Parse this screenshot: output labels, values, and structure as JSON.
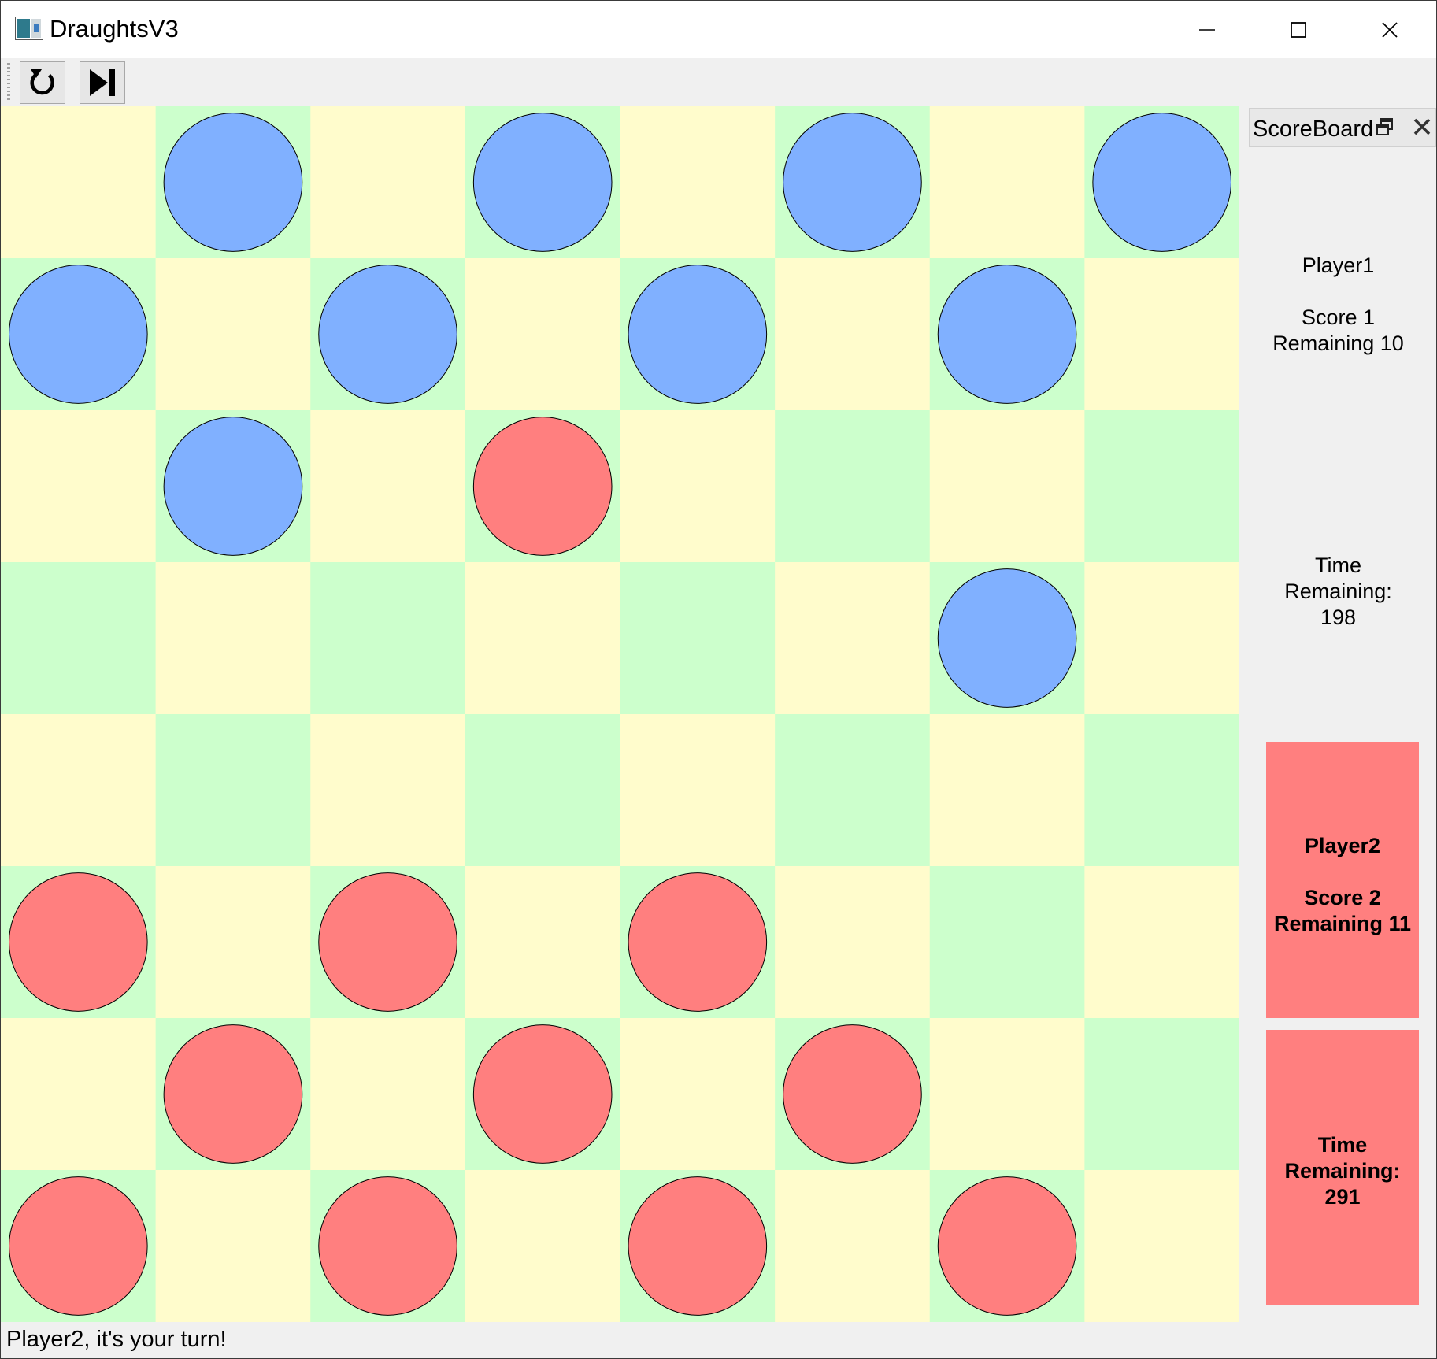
{
  "window": {
    "title": "DraughtsV3",
    "controls": [
      "minimize",
      "maximize",
      "close"
    ]
  },
  "toolbar": {
    "buttons": [
      {
        "name": "restart-button",
        "icon": "restart-icon"
      },
      {
        "name": "skip-turn-button",
        "icon": "skip-forward-icon"
      }
    ]
  },
  "board": {
    "size": 8,
    "colors": {
      "light": "#fffccc",
      "dark": "#ccffcc",
      "player1": "#80b0ff",
      "player2": "#ff7f7f"
    },
    "rows": [
      ". B . B . B . B",
      "B . B . B . B .",
      ". B . R . . . .",
      ". . . . . . B .",
      ". . . . . . . .",
      "R . R . R . . .",
      ". R . R . R . .",
      "R . R . R . R ."
    ]
  },
  "scoreboard": {
    "title": "ScoreBoard",
    "player1": {
      "name": "Player1",
      "score": "Score 1",
      "remaining": "Remaining 10",
      "time_label_1": "Time",
      "time_label_2": "Remaining:",
      "time_value": "198"
    },
    "player2": {
      "name": "Player2",
      "score": "Score 2",
      "remaining": "Remaining 11",
      "time_label_1": "Time",
      "time_label_2": "Remaining:",
      "time_value": "291",
      "active": true,
      "highlight_color": "#ff7f7f"
    }
  },
  "status": {
    "message": "Player2, it's your turn!"
  }
}
